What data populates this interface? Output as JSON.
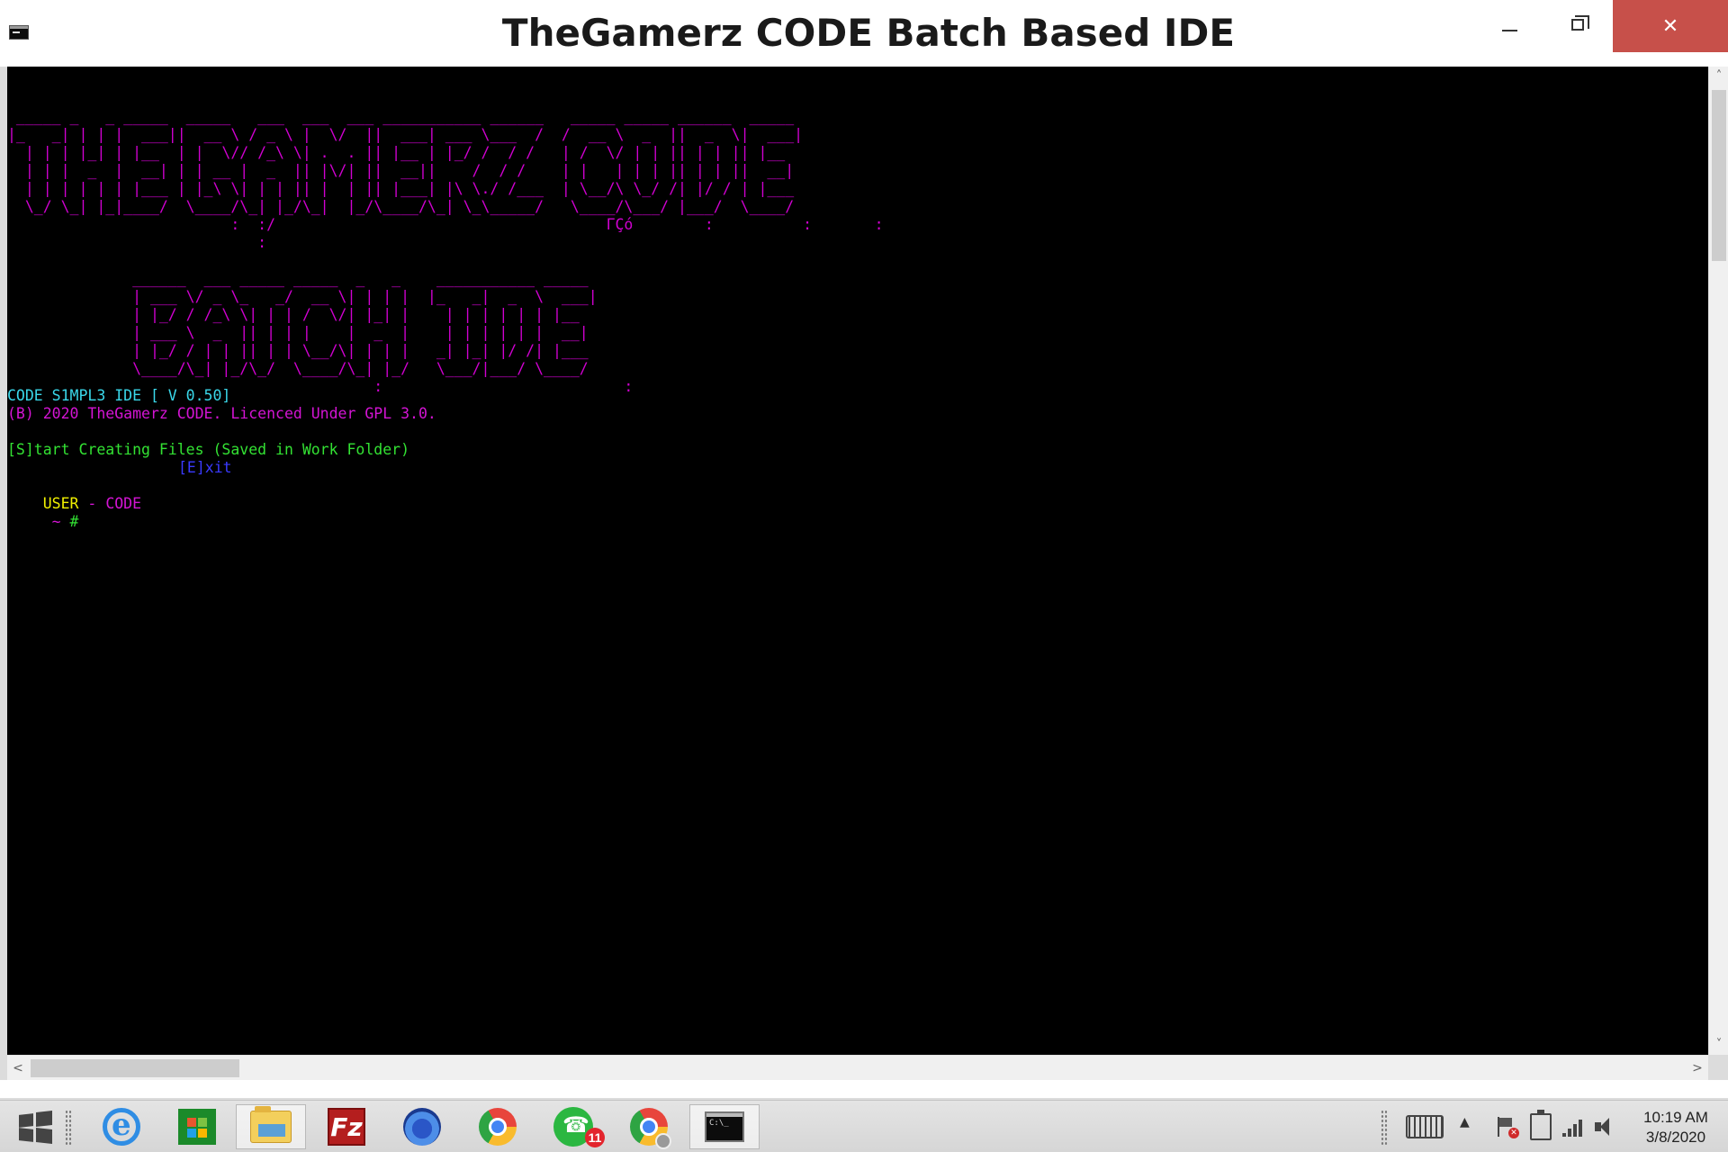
{
  "window": {
    "title": "TheGamerz CODE Batch Based IDE",
    "close_glyph": "✕"
  },
  "console": {
    "banner_top": [
      " _____ _   _ _____  _____   ___  ___  ___ ___________ ______   _____ _____ ______  _____ ",
      "|_   _| | | |  ___||  __ \\ / _ \\ |  \\/  ||  ___| ___ \\___  /  /  __ \\  _  ||  _  \\|  ___|",
      "  | | | |_| | |__  | |  \\// /_\\ \\| .  . || |__ | |_/ /  / /   | /  \\/ | | || | | || |__  ",
      "  | | |  _  |  __| | | __ |  _  || |\\/| ||  __||    /  / /    | |   | | | || | | ||  __| ",
      "  | | | | | | |___ | |_\\ \\| | | || |  | || |___| |\\ \\./ /___  | \\__/\\ \\_/ /| |/ / | |___ ",
      "  \\_/ \\_| |_|____/  \\____/\\_| |_/\\_|  |_/\\____/\\_| \\_\\_____/   \\____/\\___/ |___/  \\____/ ",
      "                         :  :/                                     ΓÇó        :          :       :",
      "                            :"
    ],
    "banner_bottom": [
      "              ______  ___ _____ _____  _   _    ___________ _____ ",
      "              | ___ \\/ _ \\_   _/  __ \\| | | |  |_   _|  _  \\  ___|",
      "              | |_/ / /_\\ \\| | | /  \\/| |_| |    | | | | | | |__  ",
      "              | ___ \\  _  || | | |    |  _  |    | | | | | |  __| ",
      "              | |_/ / | | || | | \\__/\\| | | |   _| |_| |/ /| |___ ",
      "              \\____/\\_| |_/\\_/  \\____/\\_| |_/   \\___/|___/ \\____/ ",
      "                                         :                           :"
    ],
    "version_line": "CODE S1MPL3 IDE [ V 0.50]",
    "copyright_line": "(B) 2020 TheGamerz CODE. Licenced Under GPL 3.0.",
    "start_option": "[S]tart Creating Files (Saved in Work Folder)",
    "exit_option": "[E]xit",
    "prompt_user": "USER",
    "prompt_sep": " - ",
    "prompt_host": "CODE",
    "prompt_tilde": " ~",
    "prompt_hash": " #"
  },
  "scrollbars": {
    "up": "˄",
    "down": "˅",
    "left": "<",
    "right": ">"
  },
  "taskbar": {
    "items": [
      {
        "name": "start",
        "icon": "windows-start-icon"
      },
      {
        "name": "internet-explorer",
        "icon": "internet-explorer-icon"
      },
      {
        "name": "store",
        "icon": "windows-store-icon"
      },
      {
        "name": "file-explorer",
        "icon": "folder-icon"
      },
      {
        "name": "filezilla",
        "icon": "filezilla-icon",
        "label": "Fz"
      },
      {
        "name": "firefox",
        "icon": "firefox-icon"
      },
      {
        "name": "chrome",
        "icon": "chrome-icon"
      },
      {
        "name": "whatsapp",
        "icon": "whatsapp-icon",
        "badge": "11"
      },
      {
        "name": "chrome-profile",
        "icon": "chrome-profile-icon"
      },
      {
        "name": "command-prompt",
        "icon": "command-prompt-icon"
      }
    ],
    "tray_arrow": "▲",
    "flag_x": "✕",
    "time": "10:19 AM",
    "date": "3/8/2020"
  },
  "colors": {
    "banner": "#d000d0",
    "version": "#3ad8ea",
    "copyright": "#d414d4",
    "start_option": "#33e233",
    "exit_option": "#3a3aff",
    "prompt_user": "#f2f200",
    "close_button": "#c7504a"
  }
}
